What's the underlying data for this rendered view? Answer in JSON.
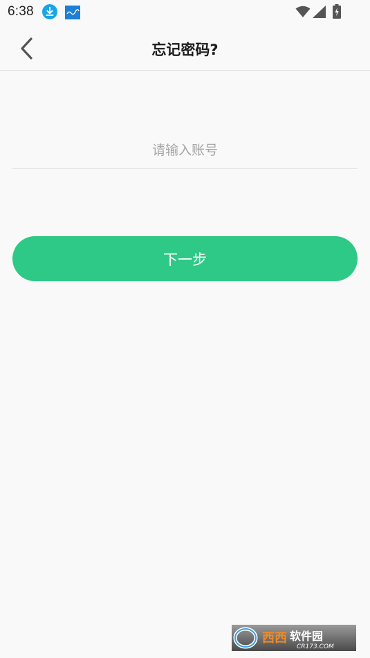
{
  "status_bar": {
    "time": "6:38",
    "icons": [
      "download-icon",
      "app-notification-icon",
      "wifi-icon",
      "cell-signal-icon",
      "battery-charging-icon"
    ]
  },
  "header": {
    "title": "忘记密码?",
    "back_icon": "chevron-left-icon"
  },
  "form": {
    "account_placeholder": "请输入账号",
    "account_value": "",
    "next_label": "下一步"
  },
  "colors": {
    "accent": "#2ec986",
    "background": "#f9f9f9",
    "download_badge": "#1aa5e6",
    "app_badge": "#1e7fd6"
  },
  "watermark": {
    "brand": "西西软件园",
    "url": "CR173.COM"
  }
}
